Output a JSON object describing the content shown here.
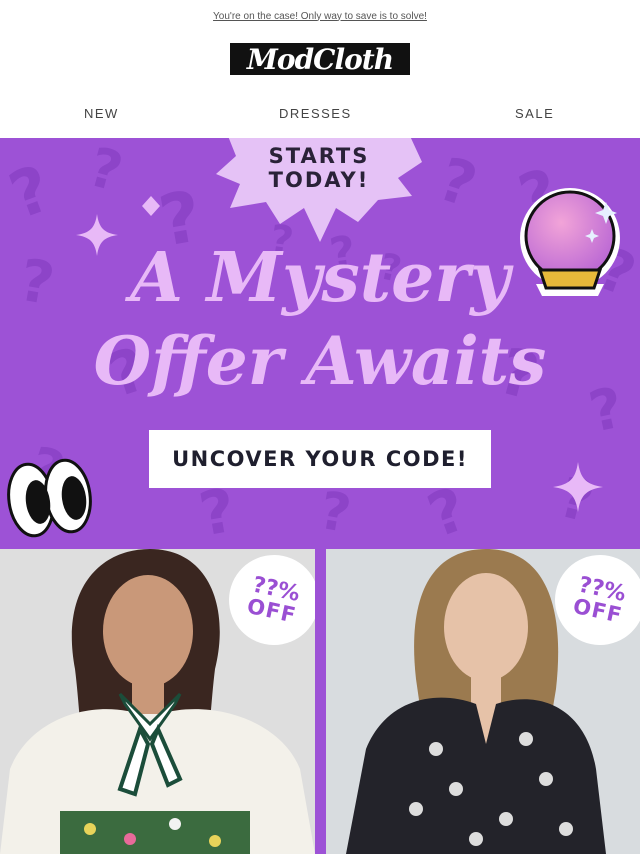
{
  "preheader": {
    "text": "You're on the case! Only way to save is to solve!"
  },
  "brand": {
    "logo_text": "ModCloth"
  },
  "nav": {
    "items": [
      {
        "label": "NEW"
      },
      {
        "label": "DRESSES"
      },
      {
        "label": "SALE"
      }
    ]
  },
  "hero": {
    "burst_line1": "STARTS",
    "burst_line2": "TODAY!",
    "headline_line1": "A Mystery",
    "headline_line2": "Offer Awaits",
    "cta_label": "UNCOVER YOUR CODE!"
  },
  "products": [
    {
      "badge_top": "??%",
      "badge_bottom": "OFF"
    },
    {
      "badge_top": "??%",
      "badge_bottom": "OFF"
    }
  ],
  "colors": {
    "hero_purple": "#9d52d6",
    "headline_lilac": "#e8b9f7",
    "burst_lilac": "#e5c2f6",
    "cta_text": "#1f1f2e",
    "badge_text": "#9a4fd3"
  }
}
